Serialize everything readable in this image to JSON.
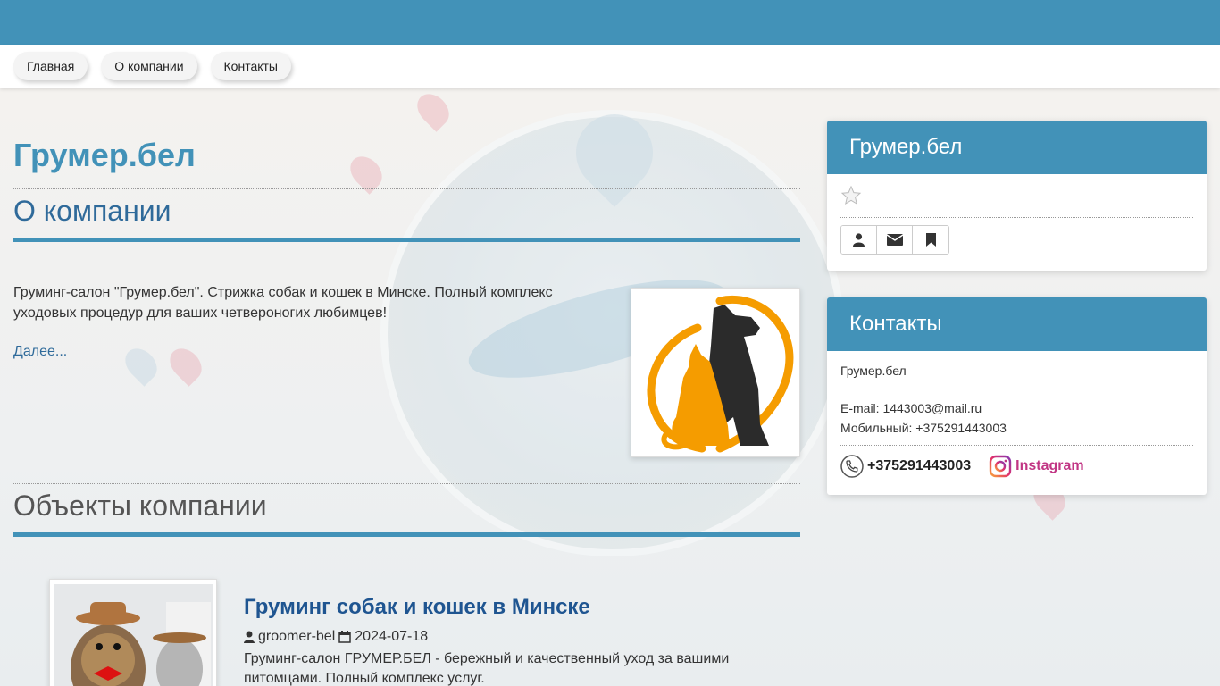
{
  "nav": {
    "items": [
      {
        "label": "Главная"
      },
      {
        "label": "О компании"
      },
      {
        "label": "Контакты"
      }
    ]
  },
  "main": {
    "site_title": "Грумер.бел",
    "about_title": "О компании",
    "about_text": "Груминг-салон \"Грумер.бел\". Стрижка собак и кошек в Минске. Полный комплекс уходовых процедур для ваших четвероногих любимцев!",
    "more_link": "Далее...",
    "objects_title": "Объекты компании",
    "article": {
      "title": "Груминг собак и кошек в Минске",
      "author": "groomer-bel",
      "date": "2024-07-18",
      "text": "Груминг-салон ГРУМЕР.БЕЛ - бережный и качественный уход за вашими питомцами. Полный комплекс услуг."
    }
  },
  "sidebar": {
    "company_panel": {
      "title": "Грумер.бел"
    },
    "contacts_panel": {
      "title": "Контакты",
      "company_name": "Грумер.бел",
      "email_line": "E-mail: 1443003@mail.ru",
      "mobile_line": "Мобильный: +375291443003",
      "phone": "+375291443003",
      "instagram": "Instagram"
    }
  },
  "colors": {
    "accent": "#4292b8",
    "link": "#2f6a9a",
    "instagram": "#c13584",
    "logo_orange": "#f59c00"
  }
}
